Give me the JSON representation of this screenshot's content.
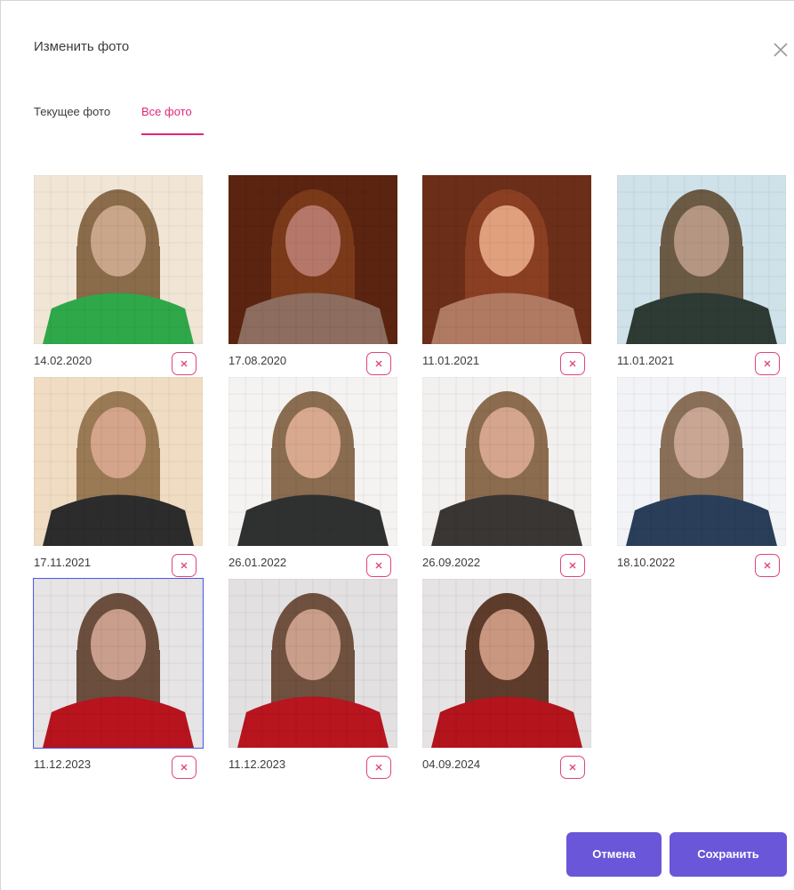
{
  "dialog": {
    "title": "Изменить фото",
    "close_icon": "close-icon"
  },
  "tabs": [
    {
      "label": "Текущее фото",
      "active": false
    },
    {
      "label": "Все фото",
      "active": true
    }
  ],
  "accent_color": "#e0277a",
  "button_color": "#6a56d8",
  "photos": [
    {
      "date": "14.02.2020",
      "palette": {
        "bg": "#f1e6d6",
        "hair": "#8a6b4a",
        "face": "#c9a58a",
        "body": "#2fa84a"
      }
    },
    {
      "date": "17.08.2020",
      "palette": {
        "bg": "#5a2410",
        "hair": "#7a3a1a",
        "face": "#b5776a",
        "body": "#8c6d60"
      }
    },
    {
      "date": "11.01.2021",
      "palette": {
        "bg": "#6b2e18",
        "hair": "#8b3f22",
        "face": "#e0a07e",
        "body": "#b07a62"
      }
    },
    {
      "date": "11.01.2021",
      "palette": {
        "bg": "#cfe2ea",
        "hair": "#6b5a44",
        "face": "#b59682",
        "body": "#2e3a34"
      }
    },
    {
      "date": "17.11.2021",
      "palette": {
        "bg": "#efdcc3",
        "hair": "#9a7a55",
        "face": "#d4a48b",
        "body": "#2c2c2c"
      }
    },
    {
      "date": "26.01.2022",
      "palette": {
        "bg": "#f5f3f1",
        "hair": "#8a6c50",
        "face": "#d8a98f",
        "body": "#2f3131"
      }
    },
    {
      "date": "26.09.2022",
      "palette": {
        "bg": "#f3f1ef",
        "hair": "#8c6c4e",
        "face": "#d5a58e",
        "body": "#3a3634"
      }
    },
    {
      "date": "18.10.2022",
      "palette": {
        "bg": "#f2f3f6",
        "hair": "#8a6f58",
        "face": "#c9a594",
        "body": "#2a3e5a"
      }
    },
    {
      "date": "11.12.2023",
      "palette": {
        "bg": "#e6e4e5",
        "hair": "#6b4e3e",
        "face": "#c99e8c",
        "body": "#b8141e"
      },
      "selected": true
    },
    {
      "date": "11.12.2023",
      "palette": {
        "bg": "#e3e0e1",
        "hair": "#70503e",
        "face": "#c99e8a",
        "body": "#b8151f"
      }
    },
    {
      "date": "04.09.2024",
      "palette": {
        "bg": "#e6e3e4",
        "hair": "#5e3c2c",
        "face": "#c99680",
        "body": "#b4141c"
      }
    }
  ],
  "delete_icon": "close-small-icon",
  "buttons": {
    "cancel": "Отмена",
    "save": "Сохранить"
  }
}
